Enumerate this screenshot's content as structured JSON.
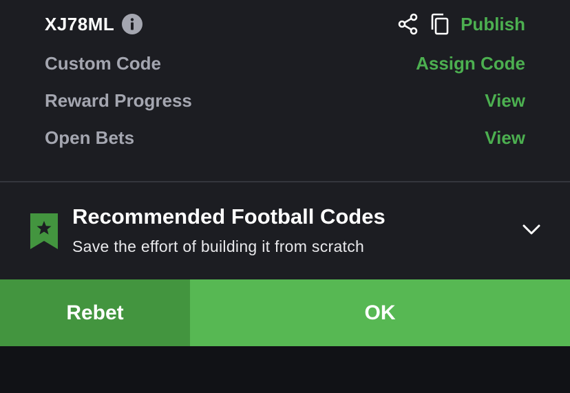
{
  "booking": {
    "code": "XJ78ML",
    "publish_label": "Publish"
  },
  "rows": [
    {
      "label": "Custom Code",
      "action": "Assign Code"
    },
    {
      "label": "Reward Progress",
      "action": "View"
    },
    {
      "label": "Open Bets",
      "action": "View"
    }
  ],
  "recommended": {
    "title": "Recommended Football Codes",
    "subtitle": "Save the effort of building it from scratch"
  },
  "buttons": {
    "rebet_label": "Rebet",
    "ok_label": "OK"
  },
  "icons": {
    "info": "info-icon",
    "share": "share-icon",
    "copy": "copy-icon",
    "bookmark": "bookmark-star-icon",
    "chevron": "chevron-down-icon"
  },
  "colors": {
    "accent_green": "#4caf50",
    "rebet_bg": "#43953f",
    "ok_bg": "#57b853",
    "background": "#1c1d22"
  }
}
